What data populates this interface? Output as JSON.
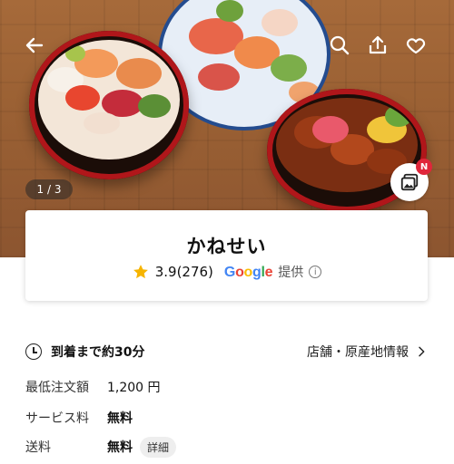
{
  "hero": {
    "pager": "1 / 3",
    "gallery_badge": "N"
  },
  "store": {
    "name": "かねせい",
    "rating": "3.9",
    "rating_count": "(276)",
    "google_letters": [
      "G",
      "o",
      "o",
      "g",
      "l",
      "e"
    ],
    "google_colors": [
      "#4285F4",
      "#EA4335",
      "#FBBC05",
      "#4285F4",
      "#34A853",
      "#EA4335"
    ],
    "provided_label": "提供"
  },
  "delivery": {
    "text": "到着まで約30分",
    "info_link": "店舗・原産地情報"
  },
  "details": [
    {
      "label": "最低注文額",
      "value": "1,200 円",
      "bold": false
    },
    {
      "label": "サービス料",
      "value": "無料",
      "bold": true
    },
    {
      "label": "送料",
      "value": "無料",
      "bold": true,
      "chip": "詳細"
    }
  ]
}
